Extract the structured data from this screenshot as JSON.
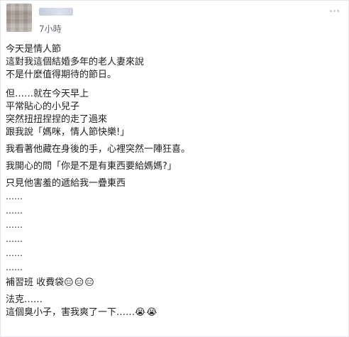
{
  "header": {
    "time": "7小時"
  },
  "icons": {
    "avatar": "avatar-icon",
    "more": "more-options-icon"
  },
  "post": {
    "p1": [
      "今天是情人節",
      "這對我這個結婚多年的老人妻來說",
      "不是什麼值得期待的節日。"
    ],
    "p2": [
      "但……就在今天早上",
      "平常貼心的小兒子",
      "突然扭扭捏捏的走了過來",
      "跟我說「媽咪，情人節快樂!」"
    ],
    "p3": "我看著他藏在身後的手，心裡突然一陣狂喜。",
    "p4": "我開心的問「你是不是有東西要給媽媽?」",
    "p5": "只見他害羞的遞給我一疊東西",
    "dots": [
      "……",
      "……",
      "……",
      "……",
      "……",
      "……"
    ],
    "p6": {
      "text": "補習班 收費袋",
      "emoji": "😑😑😑"
    },
    "p7": [
      "法克……",
      "這個臭小子，害我爽了一下……"
    ],
    "p7_emoji": "😭😭"
  }
}
